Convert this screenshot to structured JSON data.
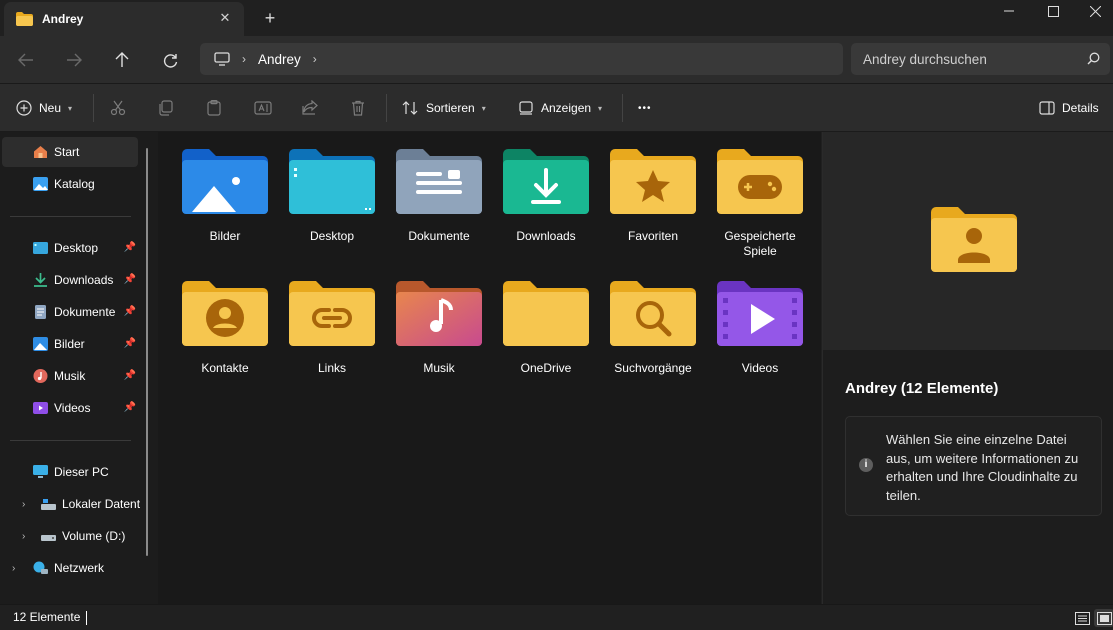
{
  "tab": {
    "title": "Andrey",
    "close": "✕",
    "new": "+"
  },
  "window": {
    "minimize": "—",
    "maximize": "☐",
    "close": "✕"
  },
  "address": {
    "breadcrumb": "Andrey"
  },
  "search": {
    "placeholder": "Andrey durchsuchen"
  },
  "toolbar": {
    "new_label": "Neu",
    "sort_label": "Sortieren",
    "view_label": "Anzeigen",
    "more_label": "•••",
    "details_label": "Details"
  },
  "sidebar": {
    "quick": [
      {
        "label": "Start"
      },
      {
        "label": "Katalog"
      }
    ],
    "pinned": [
      {
        "label": "Desktop"
      },
      {
        "label": "Downloads"
      },
      {
        "label": "Dokumente"
      },
      {
        "label": "Bilder"
      },
      {
        "label": "Musik"
      },
      {
        "label": "Videos"
      }
    ],
    "pc": {
      "label": "Dieser PC"
    },
    "drives": [
      {
        "label": "Lokaler Datent"
      },
      {
        "label": "Volume (D:)"
      }
    ],
    "network": {
      "label": "Netzwerk"
    }
  },
  "folders": [
    {
      "label": "Bilder"
    },
    {
      "label": "Desktop"
    },
    {
      "label": "Dokumente"
    },
    {
      "label": "Downloads"
    },
    {
      "label": "Favoriten"
    },
    {
      "label": "Gespeicherte Spiele"
    },
    {
      "label": "Kontakte"
    },
    {
      "label": "Links"
    },
    {
      "label": "Musik"
    },
    {
      "label": "OneDrive"
    },
    {
      "label": "Suchvorgänge"
    },
    {
      "label": "Videos"
    }
  ],
  "details": {
    "title": "Andrey (12 Elemente)",
    "info": "Wählen Sie eine einzelne Datei aus, um weitere Informationen zu erhalten und Ihre Cloudinhalte zu teilen."
  },
  "status": {
    "count": "12 Elemente"
  },
  "colors": {
    "folder_yellow": "#f6c64f",
    "folder_back": "#e8a91e",
    "background": "#191919",
    "accent": "#4cc2ff"
  }
}
